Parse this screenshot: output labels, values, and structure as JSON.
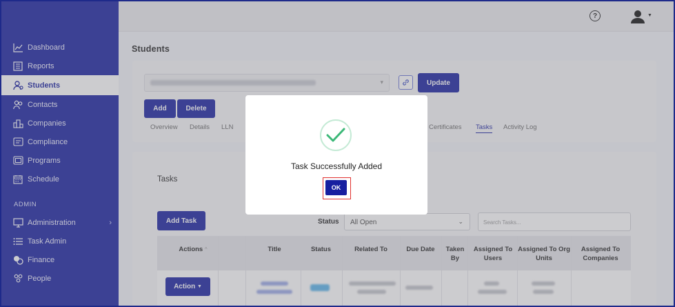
{
  "nav": {
    "items": [
      {
        "label": "Dashboard",
        "icon": "chart-line-icon"
      },
      {
        "label": "Reports",
        "icon": "report-icon"
      },
      {
        "label": "Students",
        "icon": "students-icon",
        "active": true
      },
      {
        "label": "Contacts",
        "icon": "contacts-icon"
      },
      {
        "label": "Companies",
        "icon": "companies-icon"
      },
      {
        "label": "Compliance",
        "icon": "compliance-icon"
      },
      {
        "label": "Programs",
        "icon": "programs-icon"
      },
      {
        "label": "Schedule",
        "icon": "calendar-icon"
      }
    ],
    "admin_label": "ADMIN",
    "admin_items": [
      {
        "label": "Administration",
        "icon": "monitor-icon",
        "has_submenu": true
      },
      {
        "label": "Task Admin",
        "icon": "list-icon"
      },
      {
        "label": "Finance",
        "icon": "coins-icon"
      },
      {
        "label": "People",
        "icon": "people-icon"
      }
    ]
  },
  "header": {
    "help_glyph": "?",
    "profile_icon": "user-icon"
  },
  "page": {
    "title": "Students",
    "update_label": "Update",
    "add_label": "Add",
    "delete_label": "Delete",
    "tabs": [
      {
        "label": "Overview"
      },
      {
        "label": "Details"
      },
      {
        "label": "LLN"
      },
      {
        "label": "Certificates"
      },
      {
        "label": "Tasks",
        "active": true
      },
      {
        "label": "Activity Log"
      }
    ]
  },
  "tasks": {
    "title": "Tasks",
    "add_task_label": "Add Task",
    "status_label": "Status",
    "status_value": "All Open",
    "search_placeholder": "Search Tasks...",
    "columns": [
      "Actions",
      "Title",
      "Status",
      "Related To",
      "Due Date",
      "Taken By",
      "Assigned To Users",
      "Assigned To Org Units",
      "Assigned To Companies"
    ],
    "row_action_label": "Action"
  },
  "modal": {
    "message": "Task Successfully Added",
    "ok_label": "OK",
    "check_color": "#3cb878",
    "highlight_color": "#e0302e"
  },
  "colors": {
    "primary": "#171fa0",
    "sidebar_bg": "#171fa0"
  }
}
